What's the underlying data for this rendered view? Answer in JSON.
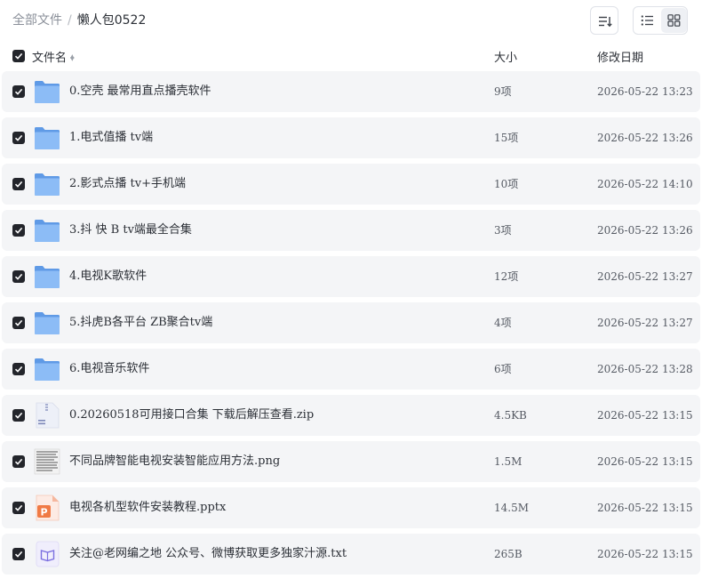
{
  "breadcrumb": {
    "root": "全部文件",
    "separator": "/",
    "current": "懒人包0522"
  },
  "toolbar": {
    "sort_icon": "sort-icon",
    "list_view_icon": "list-view-icon",
    "grid_view_icon": "grid-view-icon",
    "active_view": "grid"
  },
  "columns": {
    "name": "文件名",
    "size": "大小",
    "date": "修改日期"
  },
  "colors": {
    "folder": "#6fa8f0",
    "row_bg": "#f4f5f7",
    "checkbox": "#23252b"
  },
  "files": [
    {
      "name": "0.空壳 最常用直点播壳软件",
      "size": "9项",
      "date": "2026-05-22 13:23",
      "type": "folder",
      "checked": true
    },
    {
      "name": "1.电式值播 tv端",
      "size": "15项",
      "date": "2026-05-22 13:26",
      "type": "folder",
      "checked": true
    },
    {
      "name": "2.影式点播 tv+手机端",
      "size": "10项",
      "date": "2026-05-22 14:10",
      "type": "folder",
      "checked": true
    },
    {
      "name": "3.抖 快 B tv端最全合集",
      "size": "3项",
      "date": "2026-05-22 13:26",
      "type": "folder",
      "checked": true
    },
    {
      "name": "4.电视K歌软件",
      "size": "12项",
      "date": "2026-05-22 13:27",
      "type": "folder",
      "checked": true
    },
    {
      "name": "5.抖虎B各平台 ZB聚合tv端",
      "size": "4项",
      "date": "2026-05-22 13:27",
      "type": "folder",
      "checked": true
    },
    {
      "name": "6.电视音乐软件",
      "size": "6项",
      "date": "2026-05-22 13:28",
      "type": "folder",
      "checked": true
    },
    {
      "name": "0.20260518可用接口合集 下载后解压查看.zip",
      "size": "4.5KB",
      "date": "2026-05-22 13:15",
      "type": "zip",
      "checked": true
    },
    {
      "name": "不同品牌智能电视安装智能应用方法.png",
      "size": "1.5M",
      "date": "2026-05-22 13:15",
      "type": "image",
      "checked": true
    },
    {
      "name": "电视各机型软件安装教程.pptx",
      "size": "14.5M",
      "date": "2026-05-22 13:15",
      "type": "pptx",
      "checked": true
    },
    {
      "name": "关注@老网编之地 公众号、微博获取更多独家汁源.txt",
      "size": "265B",
      "date": "2026-05-22 13:15",
      "type": "txt",
      "checked": true
    }
  ]
}
